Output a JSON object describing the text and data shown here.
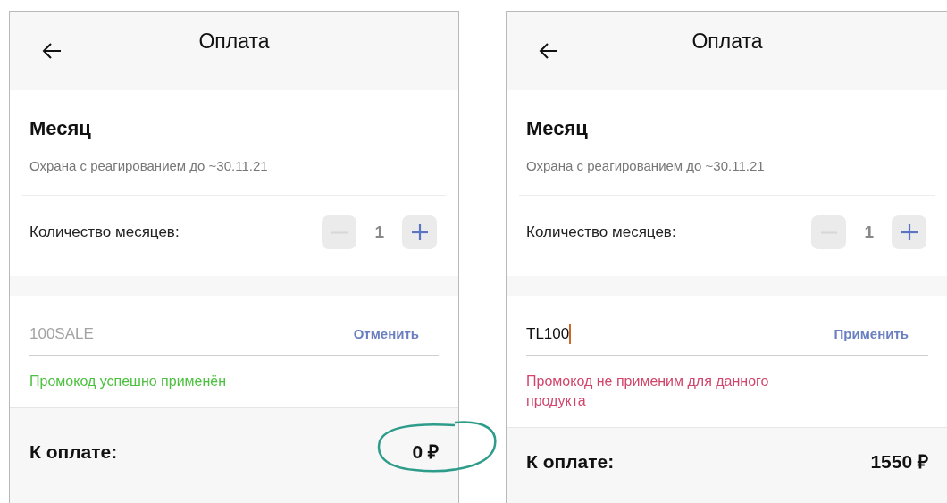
{
  "screens": [
    {
      "header": {
        "title": "Оплата"
      },
      "product": {
        "title": "Месяц",
        "subtitle": "Охрана с реагированием до ~30.11.21"
      },
      "quantity": {
        "label": "Количество месяцев:",
        "value": "1",
        "minus_disabled": true,
        "plus_disabled": false
      },
      "promo": {
        "value": "100SALE",
        "applied": true,
        "focused": false,
        "action": "Отменить",
        "message": {
          "kind": "success",
          "text": "Промокод успешно применён"
        }
      },
      "total": {
        "label": "К оплате:",
        "amount": "0 ₽",
        "circled": true
      }
    },
    {
      "header": {
        "title": "Оплата"
      },
      "product": {
        "title": "Месяц",
        "subtitle": "Охрана с реагированием до ~30.11.21"
      },
      "quantity": {
        "label": "Количество месяцев:",
        "value": "1",
        "minus_disabled": true,
        "plus_disabled": false
      },
      "promo": {
        "value": "TL100",
        "applied": false,
        "focused": true,
        "action": "Применить",
        "message": {
          "kind": "error",
          "text": "Промокод не применим для данного продукта"
        }
      },
      "total": {
        "label": "К оплате:",
        "amount": "1550 ₽",
        "circled": false
      }
    }
  ]
}
